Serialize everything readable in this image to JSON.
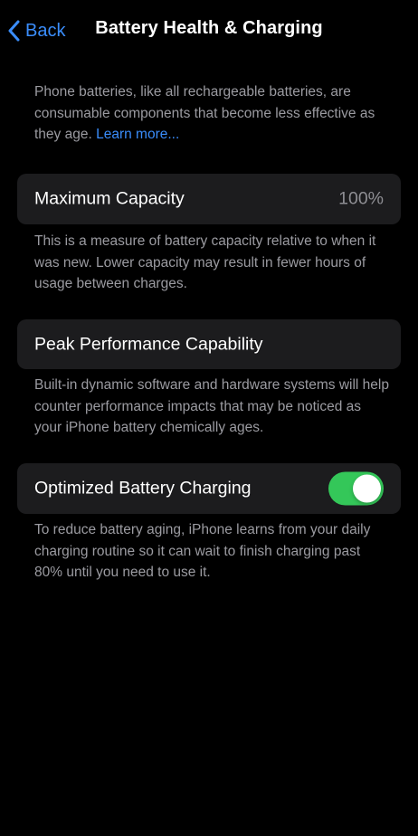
{
  "nav": {
    "back_label": "Back",
    "title": "Battery Health & Charging"
  },
  "intro": {
    "text": "Phone batteries, like all rechargeable batteries, are consumable components that become less effective as they age.",
    "link_label": "Learn more..."
  },
  "maximum_capacity": {
    "label": "Maximum Capacity",
    "value": "100%",
    "footnote": "This is a measure of battery capacity relative to when it was new. Lower capacity may result in fewer hours of usage between charges."
  },
  "peak_performance": {
    "label": "Peak Performance Capability",
    "footnote": "Built-in dynamic software and hardware systems will help counter performance impacts that may be noticed as your iPhone battery chemically ages."
  },
  "optimized_charging": {
    "label": "Optimized Battery Charging",
    "enabled": true,
    "footnote": "To reduce battery aging, iPhone learns from your daily charging routine so it can wait to finish charging past 80% until you need to use it."
  },
  "colors": {
    "background": "#000000",
    "card": "#1c1c1e",
    "accent_blue": "#3a8dfb",
    "toggle_on": "#34c759",
    "secondary_text": "#9b9ba1"
  },
  "icons": {
    "back": "chevron-left-icon"
  }
}
